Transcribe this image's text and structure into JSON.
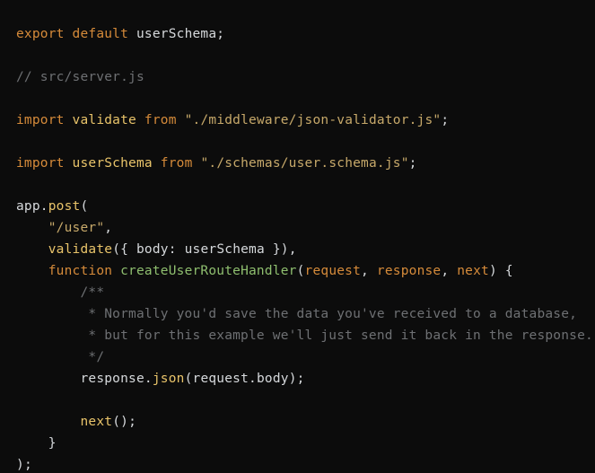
{
  "code": {
    "l1": {
      "kw_export": "export",
      "kw_default": "default",
      "ident": "userSchema",
      "semi": ";"
    },
    "l3": {
      "comment": "// src/server.js"
    },
    "l5": {
      "kw_import": "import",
      "ident": "validate",
      "kw_from": "from",
      "str": "\"./middleware/json-validator.js\"",
      "semi": ";"
    },
    "l7": {
      "kw_import": "import",
      "ident": "userSchema",
      "kw_from": "from",
      "str": "\"./schemas/user.schema.js\"",
      "semi": ";"
    },
    "l9": {
      "obj": "app",
      "dot": ".",
      "method": "post",
      "open": "("
    },
    "l10": {
      "str": "\"/user\"",
      "comma": ","
    },
    "l11": {
      "fn": "validate",
      "open": "(",
      "braceo": "{ ",
      "key": "body",
      "colon": ":",
      "val": "userSchema",
      "bracec": " }",
      "close": ")",
      "comma": ","
    },
    "l12": {
      "kw_function": "function",
      "fname": "createUserRouteHandler",
      "open": "(",
      "p1": "request",
      "c1": ",",
      "p2": "response",
      "c2": ",",
      "p3": "next",
      "close": ")",
      "braceo": " {"
    },
    "l13": {
      "c": "/**"
    },
    "l14": {
      "c": " * Normally you'd save the data you've received to a database,"
    },
    "l15": {
      "c": " * but for this example we'll just send it back in the response."
    },
    "l16": {
      "c": " */"
    },
    "l17": {
      "obj": "response",
      "dot1": ".",
      "method": "json",
      "open": "(",
      "arg": "request",
      "dot2": ".",
      "prop": "body",
      "close": ")",
      "semi": ";"
    },
    "l19": {
      "fn": "next",
      "open": "(",
      "close": ")",
      "semi": ";"
    },
    "l20": {
      "bracec": "}"
    },
    "l21": {
      "close": ")",
      "semi": ";"
    }
  }
}
